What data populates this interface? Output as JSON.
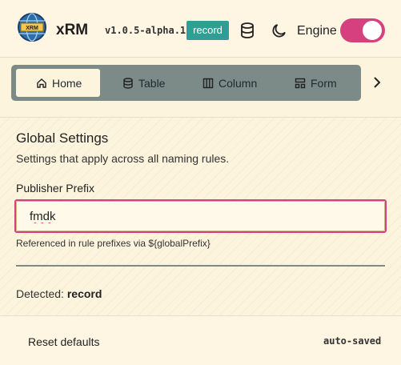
{
  "header": {
    "logo_text": "XRM",
    "app_name": "xRM",
    "version": "v1.0.5-alpha.1",
    "badge": "record",
    "engine_label": "Engine",
    "engine_enabled": true,
    "accent_color": "#d6407e",
    "badge_color": "#2f9e94"
  },
  "nav": {
    "tabs": [
      {
        "label": "Home",
        "icon": "home-icon",
        "active": true
      },
      {
        "label": "Table",
        "icon": "database-icon",
        "active": false
      },
      {
        "label": "Column",
        "icon": "columns-icon",
        "active": false
      },
      {
        "label": "Form",
        "icon": "form-icon",
        "active": false
      }
    ],
    "next_icon": "chevron-right-icon"
  },
  "settings": {
    "title": "Global Settings",
    "description": "Settings that apply across all naming rules.",
    "publisher_prefix_label": "Publisher Prefix",
    "publisher_prefix_value": "fmdk",
    "hint": "Referenced in rule prefixes via ${globalPrefix}",
    "detected_label": "Detected:",
    "detected_value": "record"
  },
  "footer": {
    "reset_label": "Reset defaults",
    "status": "auto-saved"
  }
}
